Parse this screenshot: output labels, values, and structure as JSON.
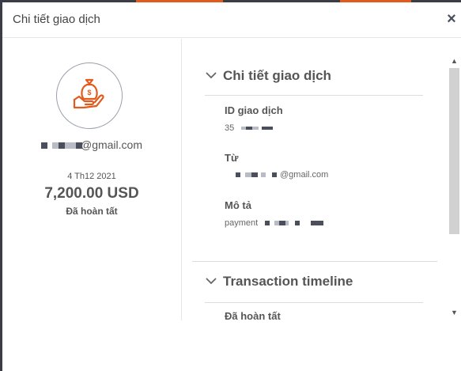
{
  "modal": {
    "title": "Chi tiết giao dịch",
    "close_label": "×"
  },
  "summary": {
    "email_suffix": "@gmail.com",
    "date": "4 Th12 2021",
    "amount": "7,200.00 USD",
    "status": "Đã hoàn tất"
  },
  "details": {
    "section_title": "Chi tiết giao dịch",
    "id_label": "ID giao dịch",
    "id_prefix": "35",
    "from_label": "Từ",
    "from_suffix": "@gmail.com",
    "desc_label": "Mô tả",
    "desc_prefix": "payment"
  },
  "timeline": {
    "section_title": "Transaction timeline",
    "first_entry": "Đã hoàn tất"
  },
  "colors": {
    "accent": "#e25a1c",
    "icon": "money-bag-hand-icon"
  }
}
